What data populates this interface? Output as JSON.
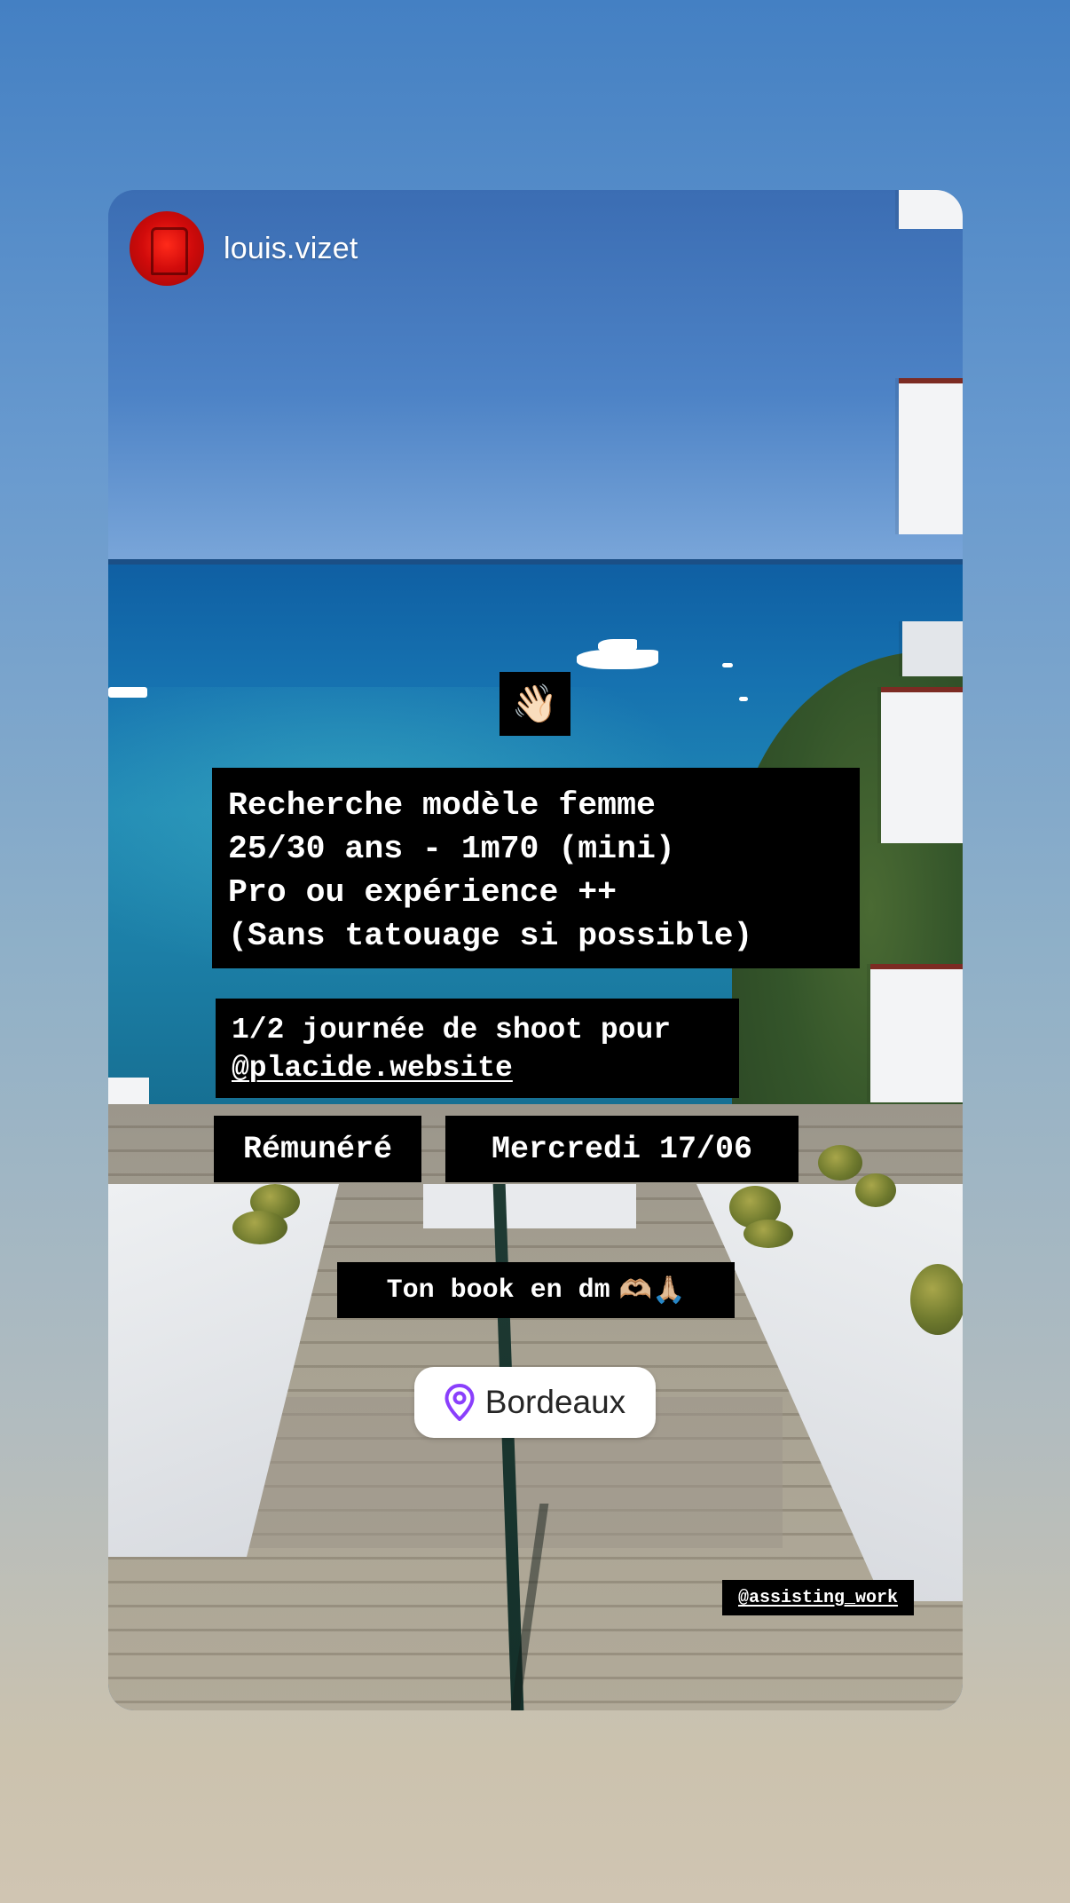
{
  "story": {
    "username": "louis.vizet",
    "stickers": {
      "wave_emoji": "👋🏻",
      "main_text": "Recherche modèle femme\n25/30 ans - 1m70 (mini)\nPro ou expérience ++\n(Sans tatouage si possible)",
      "shoot_line": "1/2 journée de shoot pour",
      "shoot_mention": "@placide.website",
      "remunere": "Rémunéré",
      "date": "Mercredi 17/06",
      "book_text": "Ton book en dm",
      "book_emojis": "🫶🏼🙏🏼",
      "location": "Bordeaux",
      "credit": "@assisting_work"
    }
  },
  "colors": {
    "background_top": "#4480c3",
    "background_bottom": "#d0c5b2",
    "sticker_bg": "#000000",
    "sticker_text": "#ffffff",
    "location_pin": "#8a3ffc",
    "avatar": "#d10b0b"
  },
  "icons": {
    "location": "map-pin-icon"
  }
}
